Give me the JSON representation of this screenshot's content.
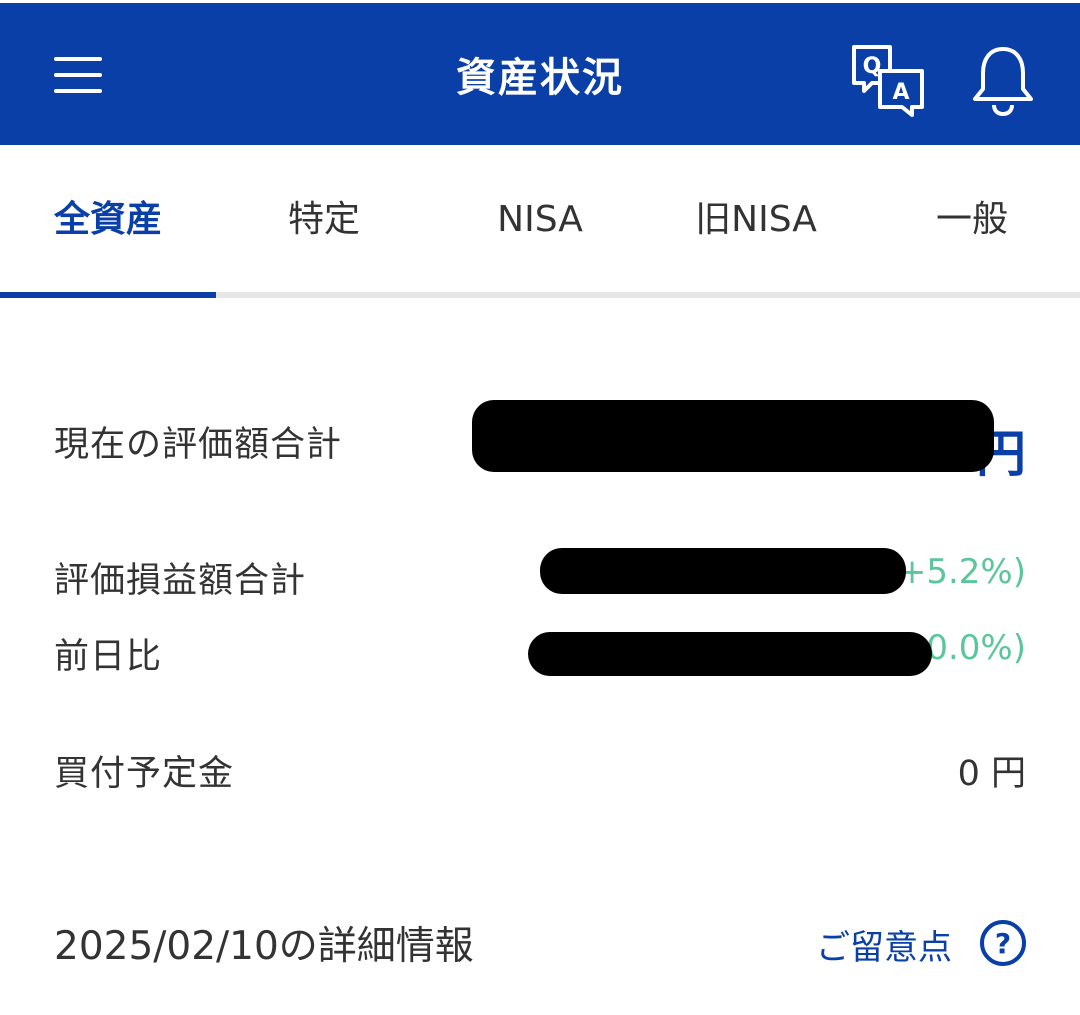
{
  "header": {
    "title": "資産状況"
  },
  "tabs": [
    {
      "label": "全資産",
      "active": true
    },
    {
      "label": "特定",
      "active": false
    },
    {
      "label": "NISA",
      "active": false
    },
    {
      "label": "旧NISA",
      "active": false
    },
    {
      "label": "一般",
      "active": false
    }
  ],
  "summary": {
    "total_label": "現在の評価額合計",
    "total_unit": "円",
    "gain_label": "評価損益額合計",
    "gain_visible": "+5.2%)",
    "day_label": "前日比",
    "day_visible": "0.0%)",
    "plan_label": "買付予定金",
    "plan_value": "0 円"
  },
  "details": {
    "title": "2025/02/10の詳細情報",
    "notes_link": "ご留意点"
  },
  "colors": {
    "brand": "#0a3fa8",
    "positive": "#5cc69b",
    "text": "#333333"
  },
  "icons": {
    "menu": "hamburger-menu-icon",
    "qa": "qa-chat-icon",
    "bell": "bell-icon",
    "help": "question-circle-icon"
  }
}
